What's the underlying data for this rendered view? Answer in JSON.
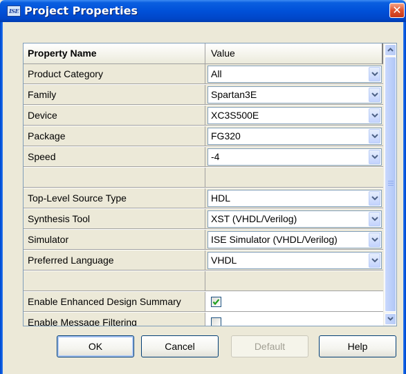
{
  "window": {
    "title": "Project Properties",
    "icon_text": "ISE",
    "close_glyph": "✕"
  },
  "grid": {
    "header": {
      "name": "Property Name",
      "value": "Value"
    },
    "rows": [
      {
        "kind": "combo",
        "name": "Product Category",
        "value": "All"
      },
      {
        "kind": "combo",
        "name": "Family",
        "value": "Spartan3E"
      },
      {
        "kind": "combo",
        "name": "Device",
        "value": "XC3S500E"
      },
      {
        "kind": "combo",
        "name": "Package",
        "value": "FG320"
      },
      {
        "kind": "combo",
        "name": "Speed",
        "value": "-4"
      },
      {
        "kind": "spacer"
      },
      {
        "kind": "combo",
        "name": "Top-Level Source Type",
        "value": "HDL"
      },
      {
        "kind": "combo",
        "name": "Synthesis Tool",
        "value": "XST (VHDL/Verilog)"
      },
      {
        "kind": "combo",
        "name": "Simulator",
        "value": "ISE Simulator (VHDL/Verilog)"
      },
      {
        "kind": "combo",
        "name": "Preferred Language",
        "value": "VHDL"
      },
      {
        "kind": "spacer"
      },
      {
        "kind": "checkbox",
        "name": "Enable Enhanced Design Summary",
        "checked": true
      },
      {
        "kind": "checkbox",
        "name": "Enable Message Filtering",
        "checked": false
      }
    ]
  },
  "buttons": {
    "ok": "OK",
    "cancel": "Cancel",
    "default": "Default",
    "help": "Help"
  },
  "colors": {
    "title_bar": "#0050d8",
    "dialog_bg": "#ece9d8",
    "checkmark": "#21a121",
    "close_button": "#e0522c"
  }
}
